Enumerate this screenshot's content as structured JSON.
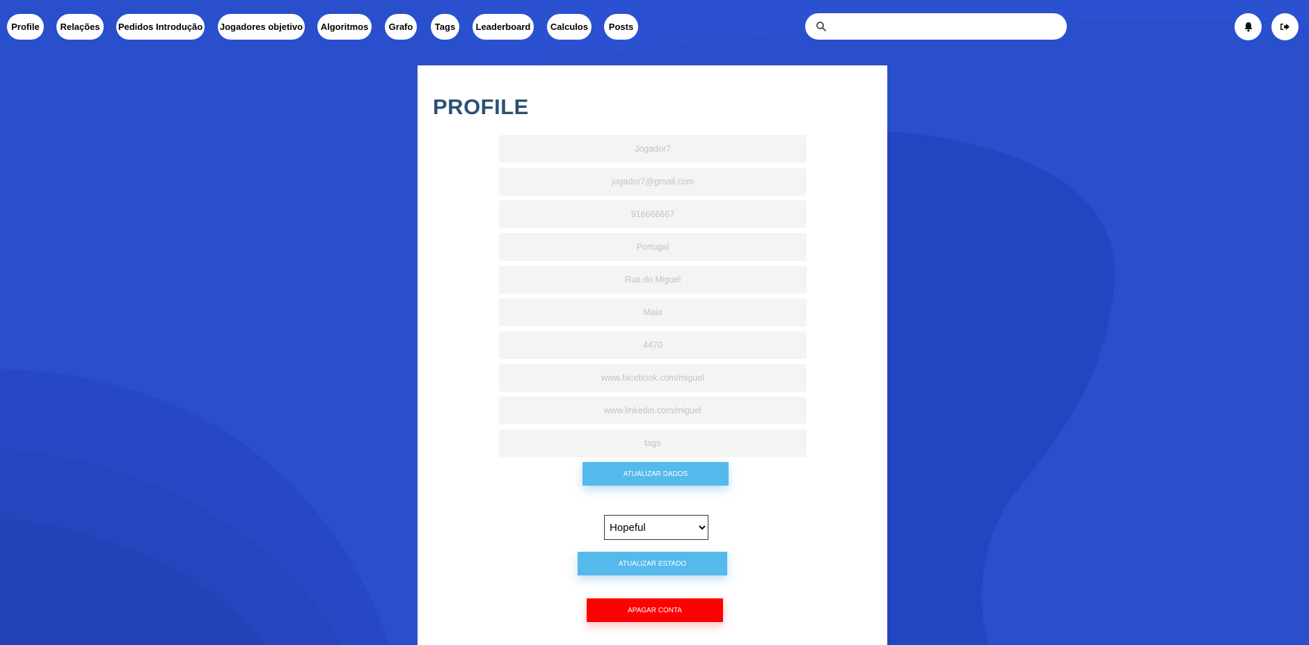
{
  "nav": {
    "items": [
      {
        "label": "Profile"
      },
      {
        "label": "Relações"
      },
      {
        "label": "Pedidos Introdução"
      },
      {
        "label": "Jogadores objetivo"
      },
      {
        "label": "Algoritmos"
      },
      {
        "label": "Grafo"
      },
      {
        "label": "Tags"
      },
      {
        "label": "Leaderboard"
      },
      {
        "label": "Calculos"
      },
      {
        "label": "Posts"
      }
    ],
    "search": {
      "placeholder": "",
      "icon": "search-icon"
    },
    "notifications_icon": "bell-icon",
    "logout_icon": "sign-out-icon"
  },
  "profile": {
    "title": "PROFILE",
    "fields": {
      "name": {
        "placeholder": "Jogador7"
      },
      "email": {
        "placeholder": "jogador7@gmail.com"
      },
      "phone": {
        "placeholder": "916666667"
      },
      "country": {
        "placeholder": "Portugal"
      },
      "street": {
        "placeholder": "Rua do Miguel"
      },
      "city": {
        "placeholder": "Maia"
      },
      "postal": {
        "placeholder": "4470"
      },
      "facebook": {
        "placeholder": "www.facebook.com/miguel"
      },
      "linkedin": {
        "placeholder": "www.linkedin.com/miguel"
      },
      "tags": {
        "placeholder": "tags"
      }
    },
    "update_data_label": "ATUALIZAR DADOS",
    "state": {
      "selected": "Hopeful"
    },
    "update_state_label": "ATUALIZAR ESTADO",
    "delete_account_label": "APAGAR CONTA"
  },
  "colors": {
    "background": "#2a4fcc",
    "primary_button": "#55b9ec",
    "danger_button": "#ff0000",
    "title": "#2c4f74"
  }
}
